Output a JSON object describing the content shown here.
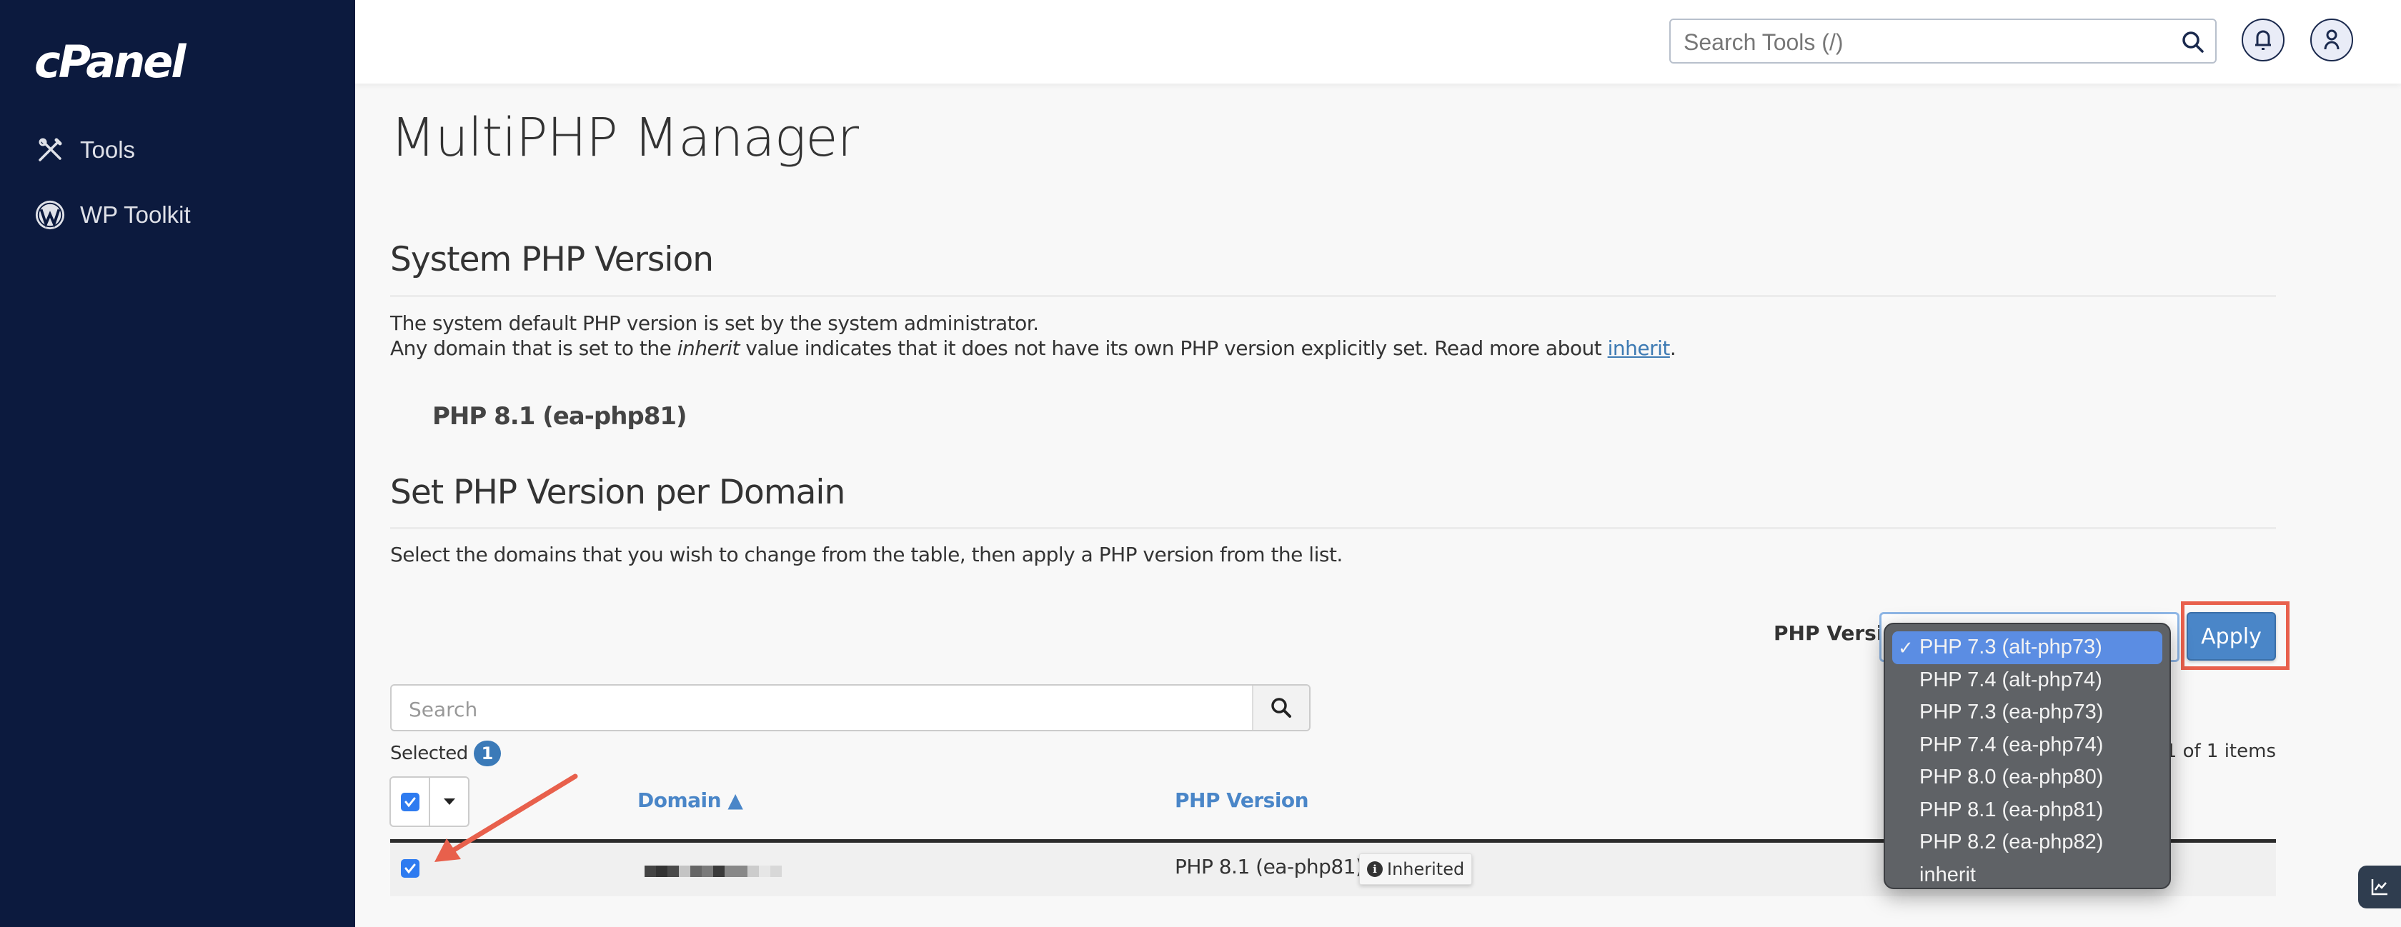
{
  "sidebar": {
    "logo": "cPanel",
    "items": [
      {
        "label": "Tools",
        "icon": "tools-icon"
      },
      {
        "label": "WP Toolkit",
        "icon": "wordpress-icon"
      }
    ]
  },
  "header": {
    "search_placeholder": "Search Tools (/)",
    "notifications_icon": "bell-icon",
    "user_icon": "user-icon"
  },
  "page": {
    "title": "MultiPHP Manager",
    "system_section": {
      "heading": "System PHP Version",
      "line1": "The system default PHP version is set by the system administrator.",
      "line2_pre": "Any domain that is set to the ",
      "line2_em": "inherit",
      "line2_mid": " value indicates that it does not have its own PHP version explicitly set. Read more about ",
      "line2_link": "inherit",
      "line2_post": ".",
      "current_version": "PHP 8.1 (ea-php81)"
    },
    "domain_section": {
      "heading": "Set PHP Version per Domain",
      "description": "Select the domains that you wish to change from the table, then apply a PHP version from the list.",
      "php_version_label": "PHP Version",
      "apply_label": "Apply",
      "dropdown": {
        "selected_index": 0,
        "check_mark": "✓",
        "options": [
          "PHP 7.3 (alt-php73)",
          "PHP 7.4 (alt-php74)",
          "PHP 7.3 (ea-php73)",
          "PHP 7.4 (ea-php74)",
          "PHP 8.0 (ea-php80)",
          "PHP 8.1 (ea-php81)",
          "PHP 8.2 (ea-php82)",
          "inherit"
        ]
      },
      "search_placeholder": "Search",
      "selected_label": "Selected",
      "selected_count": "1",
      "paging_text": "- 1 of 1 items",
      "table": {
        "columns": [
          {
            "label": "Domain",
            "sort": "▲"
          },
          {
            "label": "PHP Version"
          }
        ],
        "rows": [
          {
            "checked": true,
            "domain": "[redacted]",
            "php_version": "PHP 8.1 (ea-php81)",
            "badge": "Inherited"
          }
        ]
      }
    }
  },
  "colors": {
    "sidebar_bg": "#0c1a3e",
    "accent": "#4a86c8",
    "annotation": "#e8604c",
    "dropdown_bg": "#5f6266",
    "dropdown_selected": "#5b8de3"
  }
}
